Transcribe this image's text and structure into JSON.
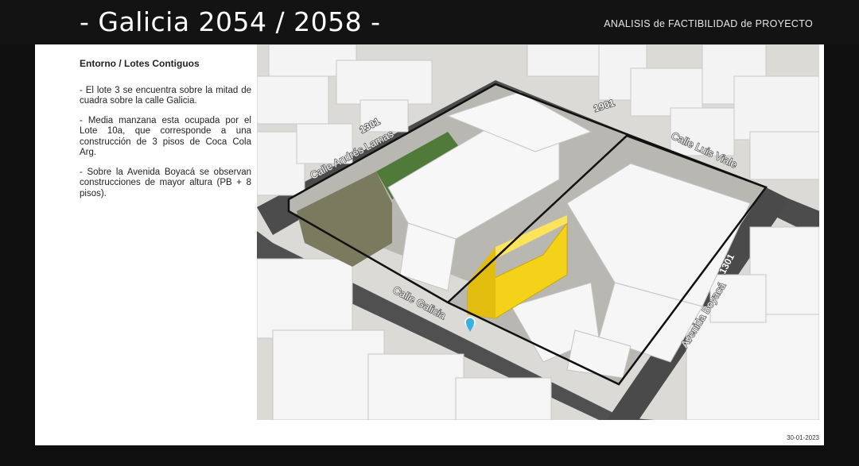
{
  "header": {
    "title": "- Galicia 2054 / 2058 -",
    "subtitle": "ANALISIS de FACTIBILIDAD de PROYECTO"
  },
  "content": {
    "section_title": "Entorno / Lotes Contiguos",
    "paragraphs": [
      "- El lote 3 se encuentra sobre la mitad de cuadra sobre la calle Galicia.",
      "- Media manzana esta ocupada por el Lote 10a, que corresponde a una construcción de 3 pisos de Coca Cola Arg.",
      "- Sobre la Avenida Boyacá se observan construcciones de mayor altura (PB + 8 pisos)."
    ]
  },
  "map": {
    "streets": {
      "andres_lamas": "Calle Andrés Lamas",
      "luis_viale": "Calle Luis Viale",
      "galicia": "Calle Galicia",
      "boyaca": "Avenida Boyacá"
    },
    "numbers": {
      "lamas": "1301",
      "viale": "1901",
      "boyaca": "1301"
    },
    "colors": {
      "highlight_lot": "#f5d21a",
      "block_outline": "#111111",
      "buildings": "#f6f6f6"
    }
  },
  "footer": {
    "date": "30-01-2023"
  }
}
